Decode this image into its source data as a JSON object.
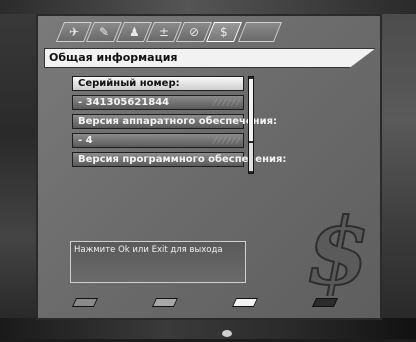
{
  "tabs": [
    {
      "icon": "satellite-dish-icon",
      "glyph": "✈"
    },
    {
      "icon": "wrench-icon",
      "glyph": "✎"
    },
    {
      "icon": "antenna-icon",
      "glyph": "♟"
    },
    {
      "icon": "tuner-icon",
      "glyph": "±"
    },
    {
      "icon": "disc-icon",
      "glyph": "⊘"
    },
    {
      "icon": "dollar-icon",
      "glyph": "$"
    }
  ],
  "header": {
    "title": "Общая информация"
  },
  "list": {
    "items": [
      {
        "label": "Серийный номер:",
        "selected": true
      },
      {
        "label": "- 341305621844",
        "selected": false
      },
      {
        "label": "Версия аппаратного обеспечения:",
        "selected": false
      },
      {
        "label": "- 4",
        "selected": false
      },
      {
        "label": "Версия программного обеспечения:",
        "selected": false
      }
    ]
  },
  "scroll": {
    "position_fraction": 0.0
  },
  "help": {
    "text": "Нажмите Ok или Exit для выхода"
  },
  "footer": {
    "keys": [
      {
        "name": "red-key",
        "color": "#8a8a8a"
      },
      {
        "name": "green-key",
        "color": "#a8a8a8"
      },
      {
        "name": "yellow-key",
        "color": "#f4f4f4"
      },
      {
        "name": "blue-key",
        "color": "#2b2b2b"
      }
    ]
  },
  "colors": {
    "panel": "#6e6e6e",
    "highlight": "#f2f2f2",
    "dark": "#1e1e1e"
  }
}
